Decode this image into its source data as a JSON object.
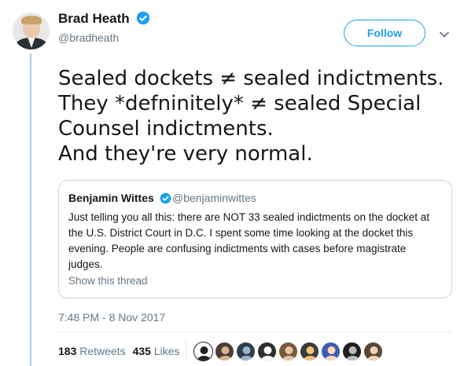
{
  "author": {
    "name": "Brad Heath",
    "handle": "@bradheath",
    "verified_icon": "verified-badge-icon"
  },
  "follow_label": "Follow",
  "tweet_lines": [
    "Sealed dockets ≠ sealed indictments.",
    "They *defninitely* ≠ sealed Special",
    "Counsel indictments.",
    "And they're very normal."
  ],
  "quote": {
    "name": "Benjamin Wittes",
    "handle": "@benjaminwittes",
    "lines": [
      "Just telling you all this: there are NOT 33 sealed indictments on the docket at",
      "the U.S. District Court in D.C. I spent some time looking at the docket this",
      "evening. People are confusing indictments with cases before magistrate",
      "judges."
    ],
    "show_thread": "Show this thread"
  },
  "timestamp": "7:48 PM - 8 Nov 2017",
  "stats": {
    "retweets_count": "183",
    "retweets_label": "Retweets",
    "likes_count": "435",
    "likes_label": "Likes"
  },
  "colors": {
    "accent": "#1da1f2",
    "thread_line": "#a4d0ec",
    "muted": "#657786"
  },
  "likers": [
    {
      "bg": "#ffffff",
      "fg": "#222222"
    },
    {
      "bg": "#4a3f3a",
      "fg": "#d7b48a"
    },
    {
      "bg": "#2c3e50",
      "fg": "#9fb3c8"
    },
    {
      "bg": "#2f2f2f",
      "fg": "#ffffff"
    },
    {
      "bg": "#7a5a3a",
      "fg": "#e2c6a0"
    },
    {
      "bg": "#3b3b3b",
      "fg": "#f0c27a"
    },
    {
      "bg": "#3e5fae",
      "fg": "#ffd7c2"
    },
    {
      "bg": "#1f1f1f",
      "fg": "#bbbbbb"
    },
    {
      "bg": "#5b4636",
      "fg": "#f2d2b6"
    }
  ]
}
